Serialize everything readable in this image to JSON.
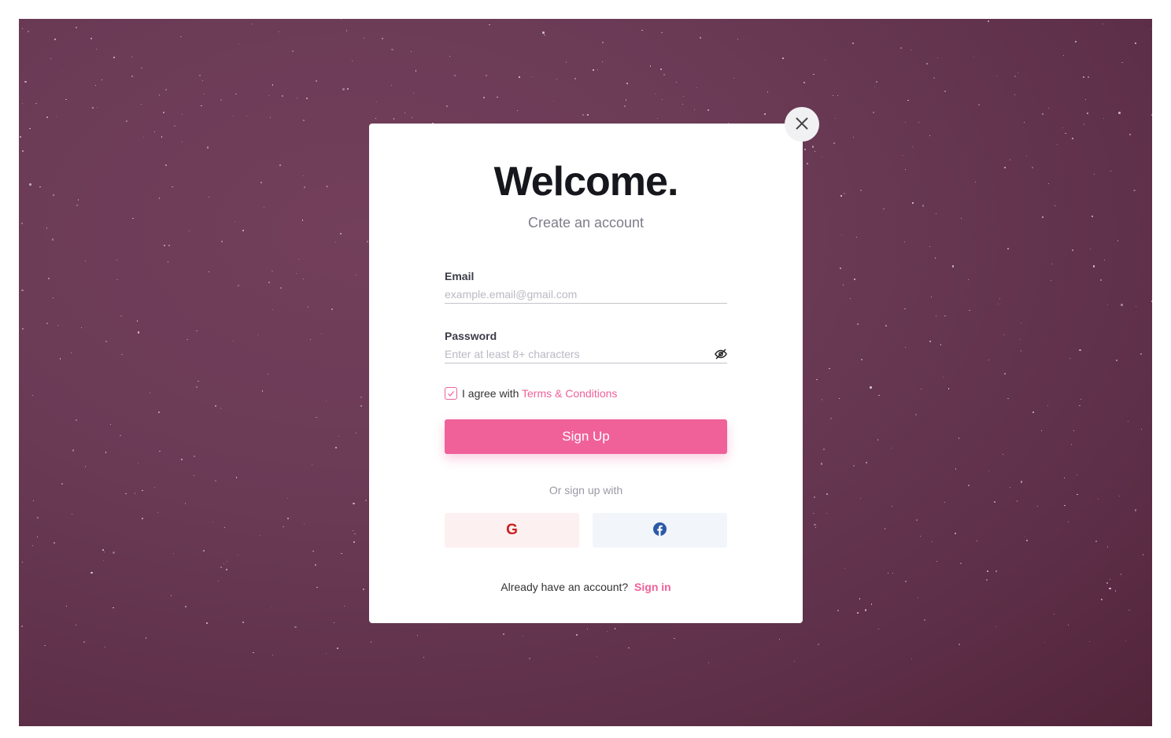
{
  "modal": {
    "title": "Welcome.",
    "subtitle": "Create an account",
    "email": {
      "label": "Email",
      "placeholder": "example.email@gmail.com"
    },
    "password": {
      "label": "Password",
      "placeholder": "Enter at least 8+ characters"
    },
    "agree_text": "I agree with",
    "terms_link": "Terms & Conditions",
    "signup_label": "Sign Up",
    "or_text": "Or sign up with",
    "footer_text": "Already have an account?",
    "signin_link": "Sign in"
  },
  "colors": {
    "accent": "#f0619a",
    "google": "#c9201f",
    "facebook": "#2d5aa8"
  }
}
